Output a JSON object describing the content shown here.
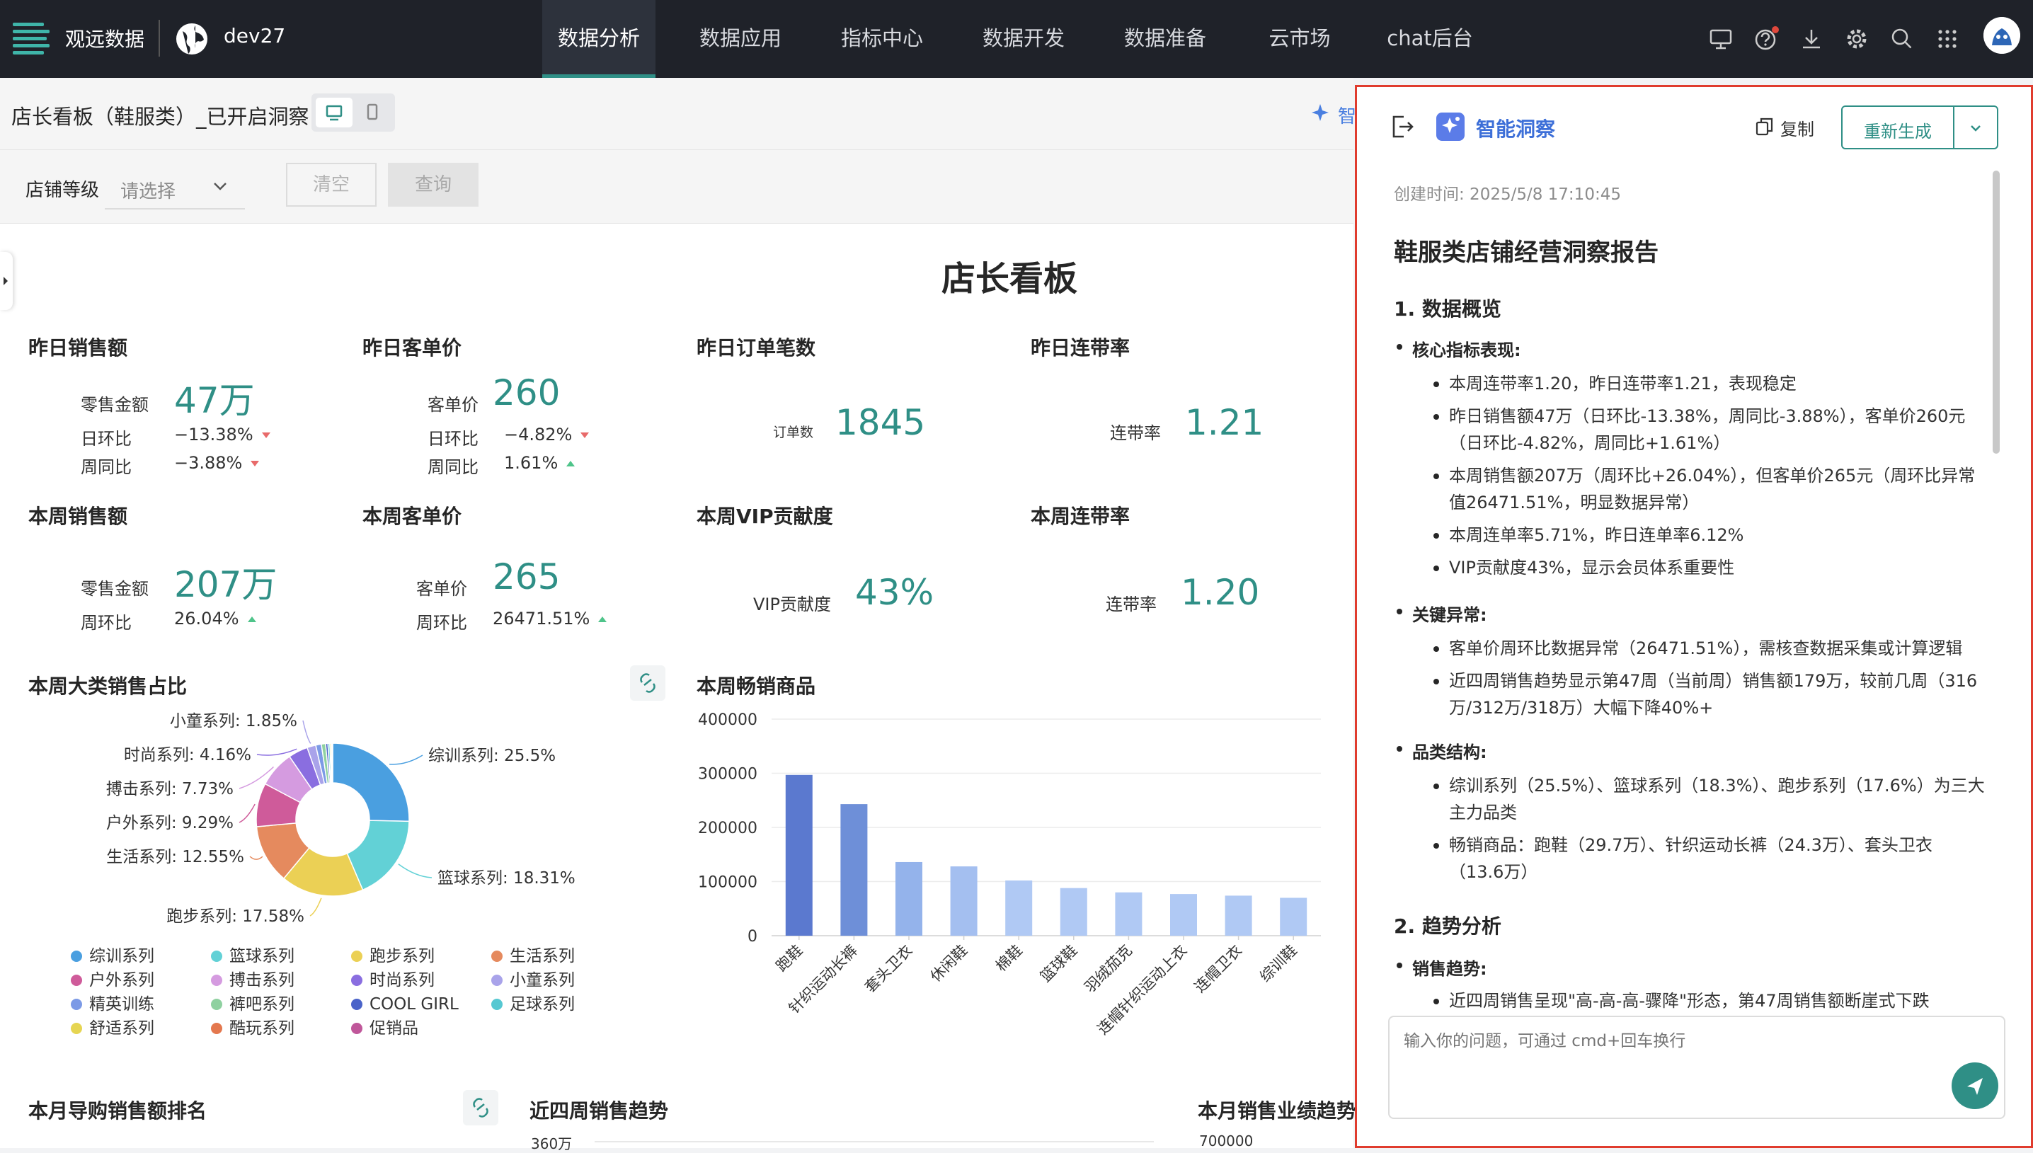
{
  "topnav": {
    "brand": "观远数据",
    "workspace": "dev27",
    "tabs": [
      {
        "label": "数据分析",
        "active": true
      },
      {
        "label": "数据应用"
      },
      {
        "label": "指标中心"
      },
      {
        "label": "数据开发"
      },
      {
        "label": "数据准备"
      },
      {
        "label": "云市场"
      },
      {
        "label": "chat后台"
      }
    ],
    "icons": [
      "screen-icon",
      "help-icon",
      "download-icon",
      "settings-icon",
      "search-icon",
      "apps-grid-icon",
      "user-avatar-icon"
    ]
  },
  "subbar": {
    "title": "店长看板（鞋服类）_已开启洞察",
    "insight_label": "智"
  },
  "filter": {
    "label": "店铺等级",
    "placeholder": "请选择",
    "clear_label": "清空",
    "query_label": "查询"
  },
  "dashboard": {
    "title": "店长看板",
    "kpis": {
      "k1": {
        "title": "昨日销售额",
        "label": "零售金额",
        "value": "47万",
        "r1_label": "日环比",
        "r1_value": "−13.38%",
        "r2_label": "周同比",
        "r2_value": "−3.88%"
      },
      "k2": {
        "title": "昨日客单价",
        "label": "客单价",
        "value": "260",
        "r1_label": "日环比",
        "r1_value": "−4.82%",
        "r2_label": "周同比",
        "r2_value": "1.61%"
      },
      "k3": {
        "title": "昨日订单笔数",
        "label": "订单数",
        "value": "1845"
      },
      "k4": {
        "title": "昨日连带率",
        "label": "连带率",
        "value": "1.21"
      },
      "k5": {
        "title": "本周销售额",
        "label": "零售金额",
        "value": "207万",
        "r1_label": "周环比",
        "r1_value": "26.04%"
      },
      "k6": {
        "title": "本周客单价",
        "label": "客单价",
        "value": "265",
        "r1_label": "周环比",
        "r1_value": "26471.51%"
      },
      "k7": {
        "title": "本周VIP贡献度",
        "label": "VIP贡献度",
        "value": "43%"
      },
      "k8": {
        "title": "本周连带率",
        "label": "连带率",
        "value": "1.20"
      }
    },
    "bottom_titles": {
      "b1": "本月导购销售额排名",
      "b2": "近四周销售趋势",
      "b3": "本月销售业绩趋势",
      "b2_tick": "360万",
      "b3_tick": "700000"
    }
  },
  "chart_data": [
    {
      "type": "pie",
      "title": "本周大类销售占比",
      "slices": [
        {
          "name": "综训系列",
          "value": 25.5,
          "color": "#4a9fe0"
        },
        {
          "name": "篮球系列",
          "value": 18.31,
          "color": "#62d1d6"
        },
        {
          "name": "跑步系列",
          "value": 17.58,
          "color": "#ebd055"
        },
        {
          "name": "生活系列",
          "value": 12.55,
          "color": "#e58a5e"
        },
        {
          "name": "户外系列",
          "value": 9.29,
          "color": "#cf5b9a"
        },
        {
          "name": "搏击系列",
          "value": 7.73,
          "color": "#d59be0"
        },
        {
          "name": "时尚系列",
          "value": 4.16,
          "color": "#8a6ee0"
        },
        {
          "name": "小童系列",
          "value": 1.85,
          "color": "#a9a3ea"
        },
        {
          "name": "精英训练",
          "value": 1.2,
          "color": "#7c9ae6"
        },
        {
          "name": "裤吧系列",
          "value": 0.9,
          "color": "#8fd1a0"
        },
        {
          "name": "COOL GIRL",
          "value": 0.5,
          "color": "#4a63c9"
        },
        {
          "name": "足球系列",
          "value": 0.4,
          "color": "#56c8d2"
        },
        {
          "name": "舒适系列",
          "value": 0.3,
          "color": "#e6d552"
        },
        {
          "name": "酷玩系列",
          "value": 0.2,
          "color": "#e4784e"
        },
        {
          "name": "促销品",
          "value": 0.1,
          "color": "#c0579a"
        }
      ],
      "labels": [
        {
          "text": "综训系列: 25.5%"
        },
        {
          "text": "篮球系列: 18.31%"
        },
        {
          "text": "跑步系列: 17.58%"
        },
        {
          "text": "生活系列: 12.55%"
        },
        {
          "text": "户外系列: 9.29%"
        },
        {
          "text": "搏击系列: 7.73%"
        },
        {
          "text": "时尚系列: 4.16%"
        },
        {
          "text": "小童系列: 1.85%"
        }
      ],
      "legend": [
        "综训系列",
        "篮球系列",
        "跑步系列",
        "生活系列",
        "户外系列",
        "搏击系列",
        "时尚系列",
        "小童系列",
        "精英训练",
        "裤吧系列",
        "COOL GIRL",
        "足球系列",
        "舒适系列",
        "酷玩系列",
        "促销品"
      ]
    },
    {
      "type": "bar",
      "title": "本周畅销商品",
      "categories": [
        "跑鞋",
        "针织运动长裤",
        "套头卫衣",
        "休闲鞋",
        "棉鞋",
        "篮球鞋",
        "羽绒茄克",
        "连帽针织运动上衣",
        "连帽卫衣",
        "综训鞋"
      ],
      "values": [
        297000,
        243000,
        136000,
        128000,
        102000,
        88000,
        80000,
        77000,
        74000,
        70000
      ],
      "ylim": [
        0,
        400000
      ],
      "yticks": [
        "400000",
        "300000",
        "200000",
        "100000",
        "0"
      ],
      "colors": [
        "#5b79cf",
        "#6e8fd8",
        "#94b3eb",
        "#a4bff0",
        "#b0c9f4",
        "#b0c9f4",
        "#b0c9f4",
        "#b0c9f4",
        "#b0c9f4",
        "#b0c9f4"
      ]
    }
  ],
  "insight_panel": {
    "title": "智能洞察",
    "copy_label": "复制",
    "regen_label": "重新生成",
    "created_time": "创建时间: 2025/5/8 17:10:45",
    "report_title": "鞋服类店铺经营洞察报告",
    "s1": "1. 数据概览",
    "core_head": "核心指标表现:",
    "core": [
      "本周连带率1.20，昨日连带率1.21，表现稳定",
      "昨日销售额47万（日环比-13.38%，周同比-3.88%），客单价260元",
      "（日环比-4.82%，周同比+1.61%）",
      "本周销售额207万（周环比+26.04%），但客单价265元（周环比异常",
      "值26471.51%，明显数据异常）",
      "本周连单率5.71%，昨日连单率6.12%",
      "VIP贡献度43%，显示会员体系重要性"
    ],
    "anomaly_head": "关键异常:",
    "anomaly": [
      "客单价周环比数据异常（26471.51%），需核查数据采集或计算逻辑",
      "近四周销售趋势显示第47周（当前周）销售额179万，较前几周（316",
      "万/312万/318万）大幅下降40%+"
    ],
    "category_head": "品类结构:",
    "category": [
      "综训系列（25.5%）、篮球系列（18.3%）、跑步系列（17.6%）为三大",
      "主力品类",
      "畅销商品：跑鞋（29.7万）、针织运动长裤（24.3万）、套头卫衣",
      "（13.6万）"
    ],
    "s2": "2. 趋势分析",
    "trend_head": "销售趋势:",
    "trend": [
      "近四周销售呈现\"高-高-高-骤降\"形态，第47周销售额断崖式下跌"
    ],
    "input_placeholder": "输入你的问题，可通过 cmd+回车换行"
  }
}
